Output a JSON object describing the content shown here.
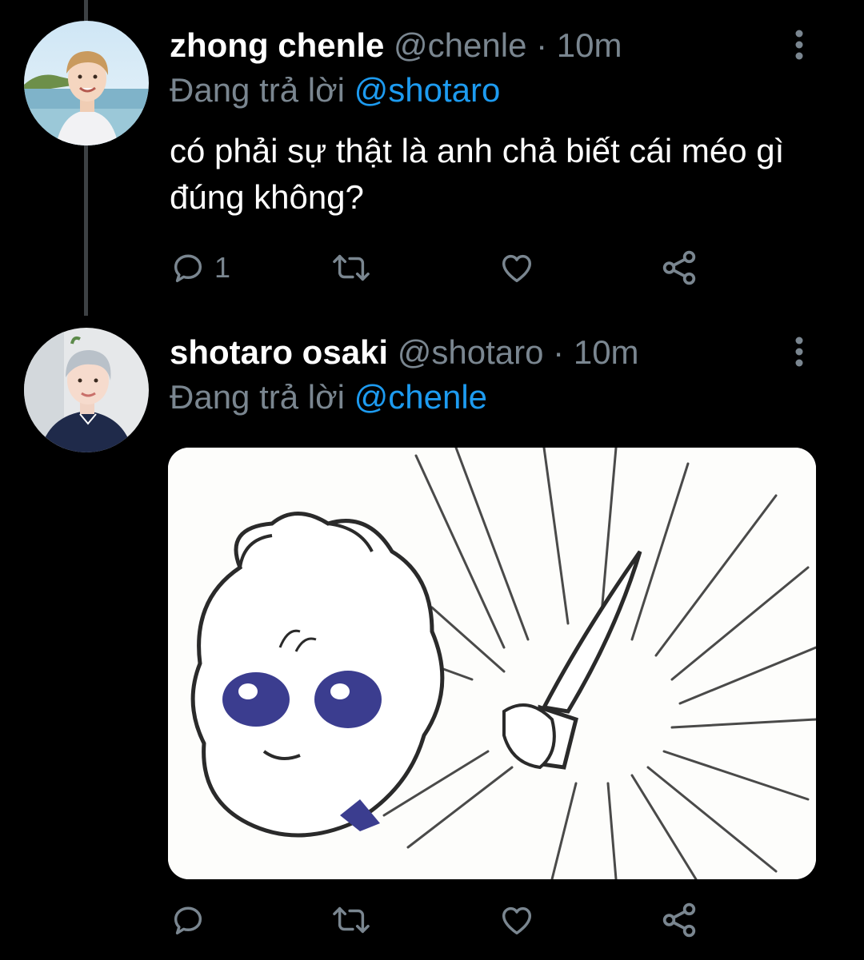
{
  "colors": {
    "background": "#000000",
    "text_primary": "#ffffff",
    "text_secondary": "#7a8690",
    "mention": "#1d9bf0",
    "thread_line": "#3d4144"
  },
  "tweets": [
    {
      "name": "zhong chenle",
      "handle": "@chenle",
      "dot": "·",
      "time": "10m",
      "reply_prefix": "Đang trả lời",
      "reply_to": "@shotaro",
      "text": "có phải sự thật là anh chả biết cái méo gì đúng không?",
      "avatar_icon": "profile-photo",
      "actions": {
        "reply_count": "1",
        "icons": [
          "reply-icon",
          "retweet-icon",
          "like-icon",
          "share-icon"
        ]
      }
    },
    {
      "name": "shotaro osaki",
      "handle": "@shotaro",
      "dot": "·",
      "time": "10m",
      "reply_prefix": "Đang trả lời",
      "reply_to": "@chenle",
      "avatar_icon": "profile-photo",
      "media": "meme-image",
      "actions": {
        "icons": [
          "reply-icon",
          "retweet-icon",
          "like-icon",
          "share-icon"
        ]
      }
    }
  ]
}
